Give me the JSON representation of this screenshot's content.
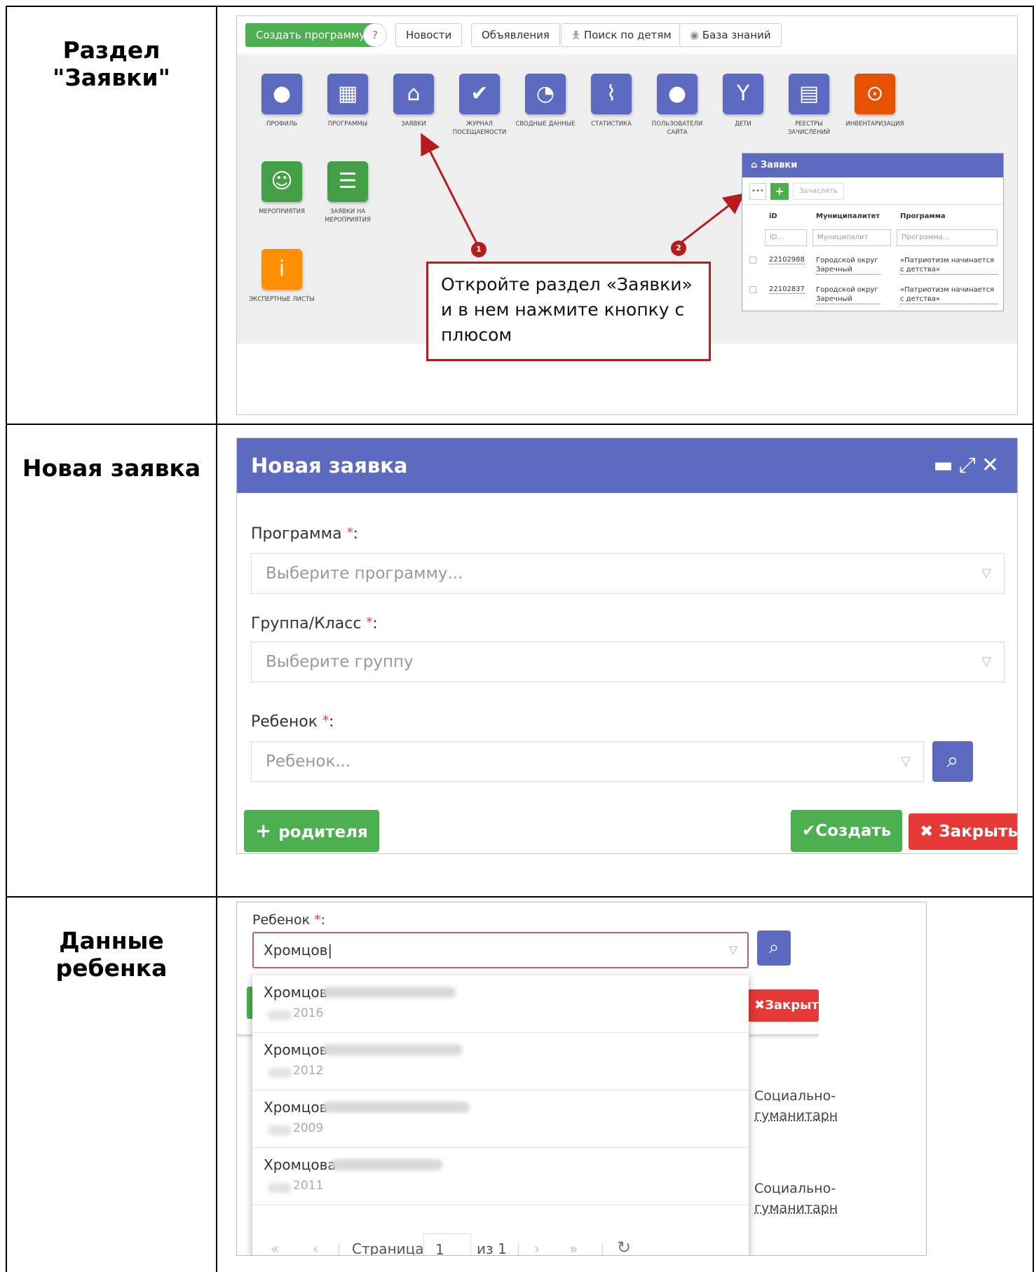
{
  "rows": [
    {
      "label": "Раздел \"Заявки\""
    },
    {
      "label": "Новая заявка"
    },
    {
      "label": "Данные ребенка"
    }
  ],
  "section1": {
    "toolbar": {
      "create": "Создать программу",
      "help": "?",
      "news": "Новости",
      "ads": "Объявления",
      "search_children": "Поиск по детям",
      "knowledge": "База знаний"
    },
    "tiles": [
      {
        "label": "ПРОФИЛЬ",
        "icon": "user-icon"
      },
      {
        "label": "ПРОГРАММЫ",
        "icon": "calendar-grid-icon"
      },
      {
        "label": "ЗАЯВКИ",
        "icon": "basket-icon"
      },
      {
        "label": "ЖУРНАЛ ПОСЕЩАЕМОСТИ",
        "icon": "calendar-check-icon"
      },
      {
        "label": "СВОДНЫЕ ДАННЫЕ",
        "icon": "gauge-icon"
      },
      {
        "label": "СТАТИСТИКА",
        "icon": "chart-icon"
      },
      {
        "label": "ПОЛЬЗОВАТЕЛИ САЙТА",
        "icon": "user-icon"
      },
      {
        "label": "ДЕТИ",
        "icon": "child-icon"
      },
      {
        "label": "РЕЕСТРЫ ЗАЧИСЛЕНИЙ",
        "icon": "register-icon"
      },
      {
        "label": "ИНВЕНТАРИЗАЦИЯ",
        "icon": "money-icon"
      },
      {
        "label": "МЕРОПРИЯТИЯ",
        "icon": "smile-icon"
      },
      {
        "label": "ЗАЯВКИ НА МЕРОПРИЯТИЯ",
        "icon": "list-icon"
      },
      {
        "label": "ЭКСПЕРТНЫЕ ЛИСТЫ",
        "icon": "info-icon"
      }
    ],
    "mini_panel": {
      "title": "Заявки",
      "enroll": "Зачислить",
      "columns": [
        "iD",
        "Муниципалитет",
        "Программа"
      ],
      "filters": [
        "iD...",
        "Муниципалит",
        "Программа..."
      ],
      "rows": [
        {
          "id": "22102988",
          "municipality": "Городской округ Заречный",
          "program": "«Патриотизм начинается с детства»"
        },
        {
          "id": "22102837",
          "municipality": "Городской округ Заречный",
          "program": "«Патриотизм начинается с детства»"
        }
      ]
    },
    "badges": [
      "1",
      "2"
    ],
    "callout": "Откройте раздел «Заявки» и в нем нажмите кнопку с плюсом"
  },
  "section2": {
    "title": "Новая заявка",
    "program_label": "Программа",
    "program_placeholder": "Выберите программу...",
    "group_label": "Группа/Класс",
    "group_placeholder": "Выберите группу",
    "child_label": "Ребенок",
    "child_placeholder": "Ребенок...",
    "required_mark": "*",
    "colon": ":",
    "add_parent": "родителя",
    "create": "Создать",
    "close": "Закрыть"
  },
  "section3": {
    "child_label": "Ребенок",
    "query": "Хромцов",
    "bg_close": "Закрыть",
    "bg_text": [
      "Социально-",
      "гуманитарн"
    ],
    "results": [
      {
        "name": "Хромцов",
        "year": "2016"
      },
      {
        "name": "Хромцов",
        "year": "2012"
      },
      {
        "name": "Хромцов",
        "year": "2009"
      },
      {
        "name": "Хромцова",
        "year": "2011"
      }
    ],
    "pager": {
      "page_label": "Страница",
      "page": "1",
      "of": "из 1"
    }
  },
  "colors": {
    "accent": "#5c6bc0",
    "green": "#4caf50",
    "red": "#e53935",
    "callout_border": "#b71c1c"
  }
}
